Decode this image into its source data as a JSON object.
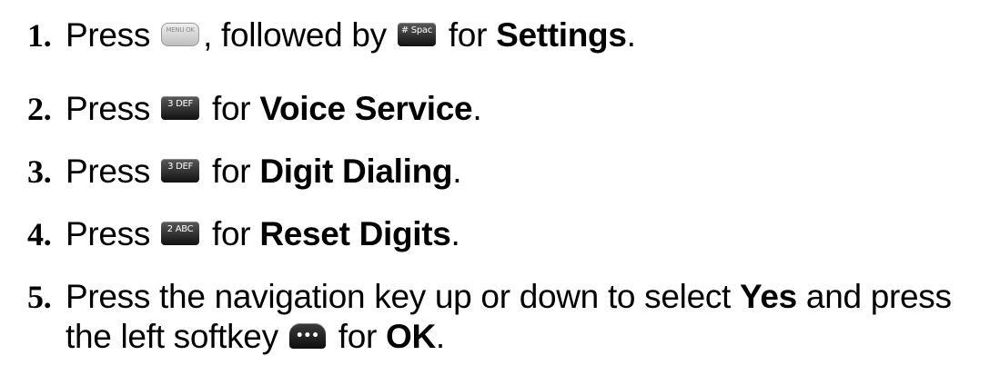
{
  "steps": [
    {
      "num": "1.",
      "t1": "Press",
      "k1": "MENU OK",
      "t2": ", followed by",
      "k2": "# Space",
      "t3": "for",
      "bold": "Settings",
      "end": "."
    },
    {
      "num": "2.",
      "t1": "Press",
      "k1": "3 DEF",
      "t2": "for",
      "bold": "Voice Service",
      "end": "."
    },
    {
      "num": "3.",
      "t1": "Press",
      "k1": "3 DEF",
      "t2": "for",
      "bold": "Digit Dialing",
      "end": "."
    },
    {
      "num": "4.",
      "t1": "Press",
      "k1": "2 ABC",
      "t2": "for",
      "bold": "Reset Digits",
      "end": "."
    },
    {
      "num": "5.",
      "t1": "Press the navigation key up or down to select",
      "bold1": "Yes",
      "t2": "and press",
      "line2_t1": "the left softkey",
      "k1": "•••",
      "line2_t2": "for",
      "bold2": "OK",
      "end": "."
    }
  ],
  "icons": {
    "menu_ok_key": "menu-ok-key-icon",
    "pound_key": "pound-space-key-icon",
    "three_key": "three-def-key-icon",
    "two_key": "two-abc-key-icon",
    "left_softkey": "left-softkey-icon"
  }
}
